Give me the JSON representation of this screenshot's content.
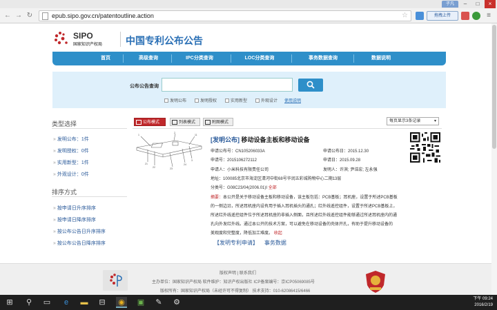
{
  "browser": {
    "user_badge": "子凡",
    "url": "epub.sipo.gov.cn/patentoutline.action",
    "upload_label": "拖拽上传"
  },
  "site": {
    "logo_text": "SIPO",
    "logo_cn": "国家知识产权局",
    "title": "中国专利公布公告"
  },
  "nav": [
    "首页",
    "高级查询",
    "IPC分类查询",
    "LOC分类查询",
    "事务数据查询",
    "数据说明"
  ],
  "search": {
    "label": "公布公告查询",
    "value": "",
    "options": [
      "发明公布",
      "发明授权",
      "实用新型",
      "外观设计"
    ],
    "help_link": "使用说明"
  },
  "sidebar": {
    "type_heading": "类型选择",
    "types": [
      "发明公布：1件",
      "发明授权：0件",
      "实用新型：1件",
      "外观设计：0件"
    ],
    "sort_heading": "排序方式",
    "sorts": [
      "按申请日升序排序",
      "按申请日降序排序",
      "按公布公告日升序排序",
      "按公布公告日降序排序"
    ]
  },
  "views": {
    "tabs": [
      "公布模式",
      "列表模式",
      "附图模式"
    ],
    "per_page": "每页显示3条记录"
  },
  "result": {
    "tag": "[发明公布]",
    "title": "移动设备主板和移动设备",
    "pub_no": "申请公布号：CN105206033A",
    "pub_date": "申请公布日：2015.12.30",
    "app_no": "申请号：2015106272112",
    "app_date": "申请日：2015.09.28",
    "applicant": "申请人：小米科技有限责任公司",
    "inventors": "发明人：许滨; 尹浩宏; 左永强",
    "address": "地址：100085北京市海淀区清河中街68号华润五彩城购物中心二期13层",
    "ipc": "分类号：G08C23/04(2006.01)I",
    "ipc_all": "全部",
    "abstract_label": "摘要：",
    "abstract_lines": [
      "本公开是关于移动设备主板和移动设备，该主板包括：PCB基板；耳机座，设置于所述PCB基板",
      "的一侧边沿，所述耳机座内设有用于插入耳机插头的通孔；红外线遥控组件，设置于所述PCB基板上，",
      "所述红外线遥控组件位于所述耳机座的非插入侧面，且所述红外线遥控组件能够通过所述耳机座内的通",
      "孔向外发红外线。通过本公开的技术方案，可以避免在移动设备的壳体开孔，有助于提升移动设备的",
      "美观度和完整度，降低加工难度。"
    ],
    "expand": "收起",
    "link_apply": "【发明专利申请】",
    "link_affairs": "事务数据"
  },
  "footer": {
    "links": "版权声明 | 联系我们",
    "host": "主办单位：国家知识产权局  软件维护：知识产权出版社  ICP备案编号：京ICP05069085号",
    "rights": "版权所有：国家知识产权局（未经许可不得复制）  技术支持：010-62086415/6466"
  },
  "taskbar": {
    "time": "下午 09:24",
    "date": "2016/2/19"
  },
  "colors": {
    "nav_blue": "#2e8fc9",
    "accent_red": "#c0282b",
    "title_blue": "#2a6fb5"
  }
}
